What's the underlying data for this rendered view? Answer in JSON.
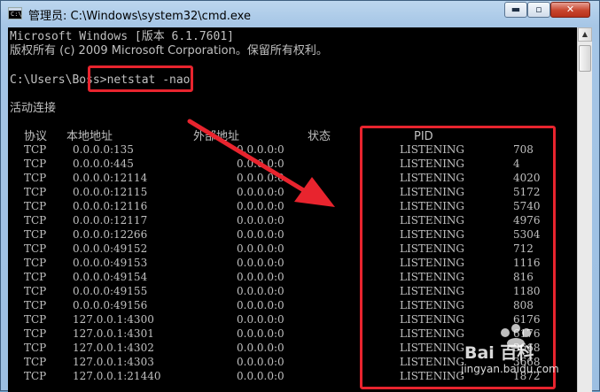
{
  "window": {
    "icon_glyph": "C:\\",
    "title": "管理员: C:\\Windows\\system32\\cmd.exe",
    "min_glyph": "▬",
    "max_glyph": "▫",
    "close_glyph": "✕"
  },
  "console": {
    "line1": "Microsoft Windows [版本 6.1.7601]",
    "line2": "版权所有 (c) 2009 Microsoft Corporation。保留所有权利。",
    "prompt": "C:\\Users\\Boss>",
    "command": "netstat -nao",
    "section_title": "活动连接",
    "headers": [
      "协议",
      "本地地址",
      "外部地址",
      "状态",
      "PID"
    ],
    "rows": [
      [
        "TCP",
        "0.0.0.0:135",
        "0.0.0.0:0",
        "LISTENING",
        "708"
      ],
      [
        "TCP",
        "0.0.0.0:445",
        "0.0.0.0:0",
        "LISTENING",
        "4"
      ],
      [
        "TCP",
        "0.0.0.0:12114",
        "0.0.0.0:0",
        "LISTENING",
        "4020"
      ],
      [
        "TCP",
        "0.0.0.0:12115",
        "0.0.0.0:0",
        "LISTENING",
        "5172"
      ],
      [
        "TCP",
        "0.0.0.0:12116",
        "0.0.0.0:0",
        "LISTENING",
        "5740"
      ],
      [
        "TCP",
        "0.0.0.0:12117",
        "0.0.0.0:0",
        "LISTENING",
        "4976"
      ],
      [
        "TCP",
        "0.0.0.0:12266",
        "0.0.0.0:0",
        "LISTENING",
        "5304"
      ],
      [
        "TCP",
        "0.0.0.0:49152",
        "0.0.0.0:0",
        "LISTENING",
        "712"
      ],
      [
        "TCP",
        "0.0.0.0:49153",
        "0.0.0.0:0",
        "LISTENING",
        "1116"
      ],
      [
        "TCP",
        "0.0.0.0:49154",
        "0.0.0.0:0",
        "LISTENING",
        "816"
      ],
      [
        "TCP",
        "0.0.0.0:49155",
        "0.0.0.0:0",
        "LISTENING",
        "1180"
      ],
      [
        "TCP",
        "0.0.0.0:49156",
        "0.0.0.0:0",
        "LISTENING",
        "808"
      ],
      [
        "TCP",
        "127.0.0.1:4300",
        "0.0.0.0:0",
        "LISTENING",
        "6176"
      ],
      [
        "TCP",
        "127.0.0.1:4301",
        "0.0.0.0:0",
        "LISTENING",
        "6176"
      ],
      [
        "TCP",
        "127.0.0.1:4302",
        "0.0.0.0:0",
        "LISTENING",
        "3668"
      ],
      [
        "TCP",
        "127.0.0.1:4303",
        "0.0.0.0:0",
        "LISTENING",
        "3668"
      ],
      [
        "TCP",
        "127.0.0.1:21440",
        "0.0.0.0:0",
        "LISTENING",
        "1872"
      ]
    ]
  },
  "scrollbar": {
    "up_glyph": "▲"
  },
  "annotations": {
    "highlight_color": "#e8242e"
  },
  "watermark": {
    "brand": "Bai 百科",
    "url": "jingyan.baidu.com"
  }
}
